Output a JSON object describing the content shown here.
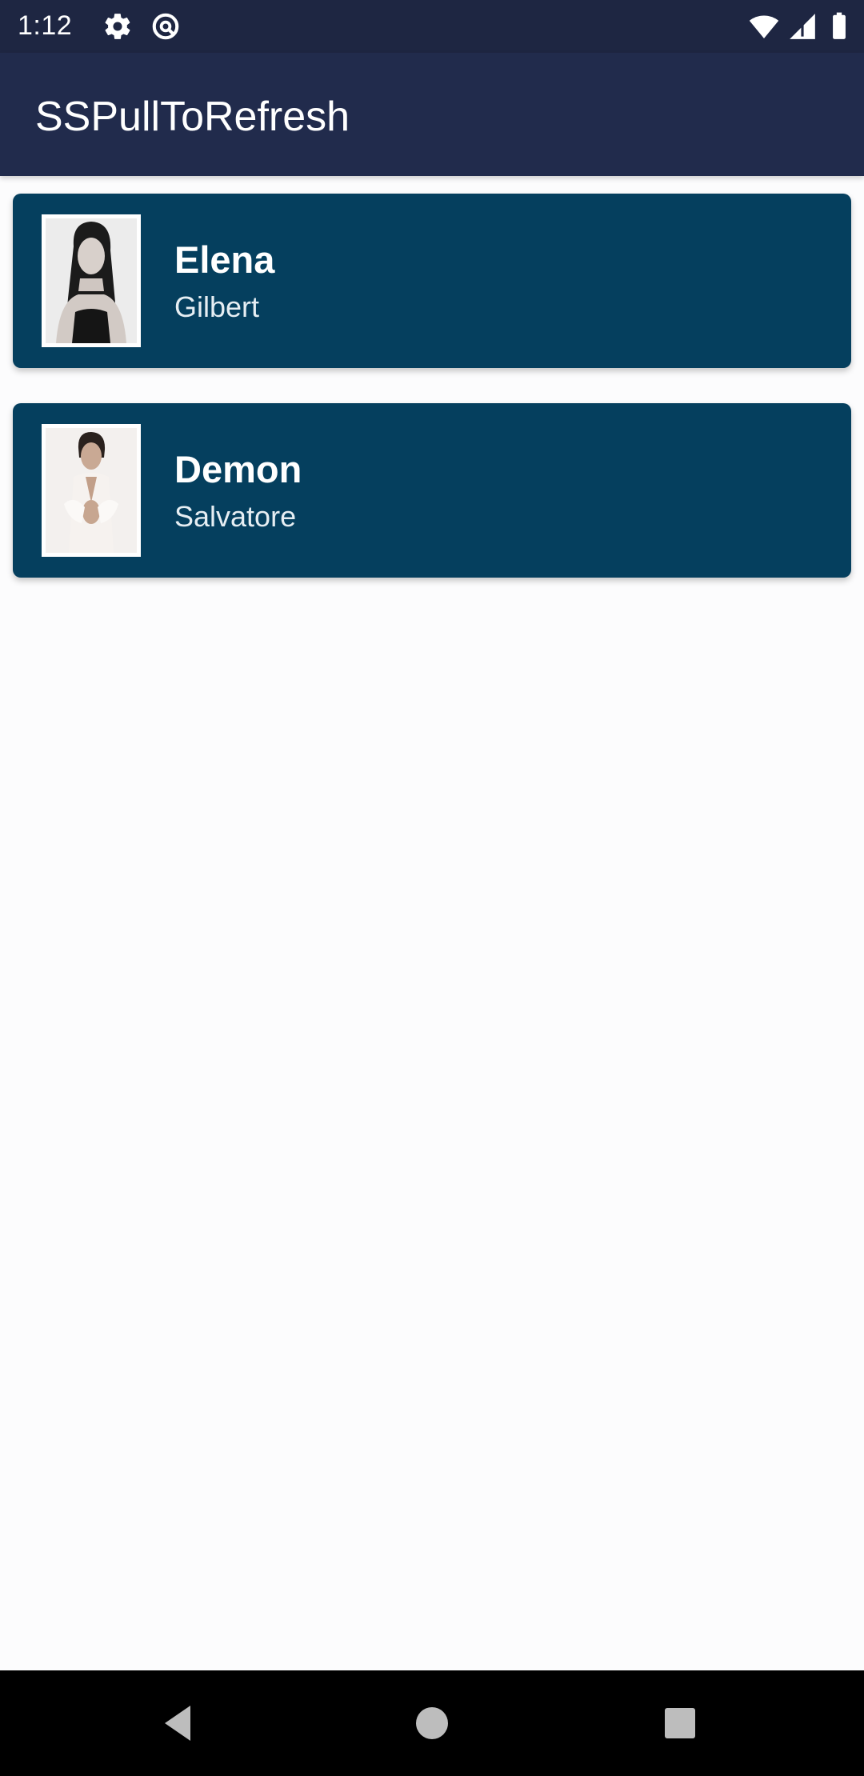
{
  "status_bar": {
    "time": "1:12",
    "icons": [
      "gear-icon",
      "sync-icon",
      "wifi-icon",
      "signal-icon",
      "battery-icon"
    ]
  },
  "app_bar": {
    "title": "SSPullToRefresh"
  },
  "list": {
    "items": [
      {
        "first_name": "Elena",
        "last_name": "Gilbert",
        "avatar": "portrait-photo"
      },
      {
        "first_name": "Demon",
        "last_name": "Salvatore",
        "avatar": "portrait-photo"
      }
    ]
  },
  "nav_bar": {
    "icons": [
      "back-icon",
      "home-icon",
      "recents-icon"
    ]
  },
  "colors": {
    "status_bar": "#1e2642",
    "app_bar": "#212b4c",
    "card": "#053f5e",
    "background": "#fcfcfd"
  }
}
